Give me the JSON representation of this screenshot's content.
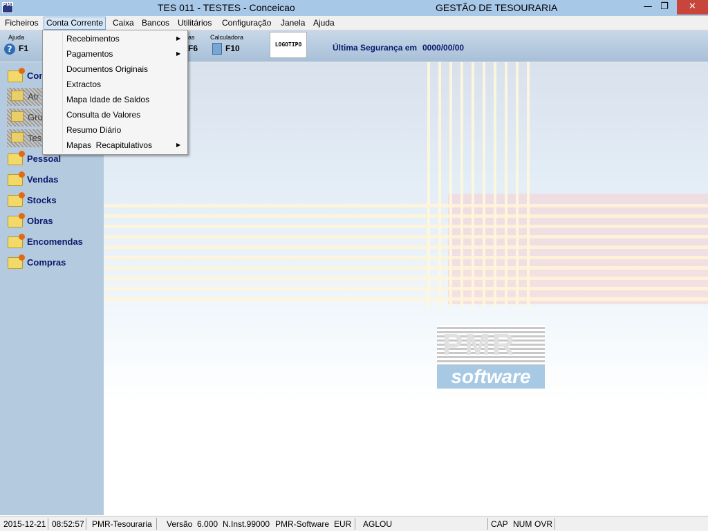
{
  "window": {
    "icon_text": "PMR",
    "title": "TES 011 - TESTES - Conceicao",
    "app_heading": "GESTÃO DE TESOURARIA",
    "min_glyph": "—",
    "restore_glyph": "❐",
    "close_glyph": "✕"
  },
  "menubar": {
    "items": [
      "Ficheiros",
      "Conta Corrente",
      "Caixa",
      "Bancos",
      "Utilitários",
      "Configuração",
      "Janela",
      "Ajuda"
    ],
    "active": "Conta Corrente"
  },
  "toolbar": {
    "help_label": "Ajuda",
    "help_key": "F1",
    "help_icon": "question-mark-icon",
    "caixas_label_partial": "as",
    "caixas_key": "F6",
    "calc_label": "Calculadora",
    "calc_key": "F10",
    "calc_icon": "calculator-icon",
    "logo_text": "LOGOTIPO",
    "security_label": "Última Segurança em",
    "security_value": "0000/00/00"
  },
  "sidebar": {
    "items": [
      {
        "label": "Con",
        "icon": "folder-icon"
      },
      {
        "label": "Pessoal",
        "icon": "folder-icon"
      },
      {
        "label": "Vendas",
        "icon": "folder-icon"
      },
      {
        "label": "Stocks",
        "icon": "folder-icon"
      },
      {
        "label": "Obras",
        "icon": "folder-icon"
      },
      {
        "label": "Encomendas",
        "icon": "folder-icon"
      },
      {
        "label": "Compras",
        "icon": "folder-icon"
      }
    ],
    "subitems": [
      {
        "label": "Atr"
      },
      {
        "label": "Gru"
      },
      {
        "label": "Tes"
      }
    ]
  },
  "dropdown": {
    "items": [
      {
        "label": "Recebimentos",
        "submenu": true
      },
      {
        "label": "Pagamentos",
        "submenu": true
      },
      {
        "label": "Documentos Originais",
        "submenu": false
      },
      {
        "label": "Extractos",
        "submenu": false
      },
      {
        "label": "Mapa Idade de Saldos",
        "submenu": false
      },
      {
        "label": "Consulta de Valores",
        "submenu": false
      },
      {
        "label": "Resumo Diário",
        "submenu": false
      },
      {
        "label": "Mapas  Recapitulativos",
        "submenu": true
      }
    ],
    "arrow_glyph": "▶"
  },
  "workspace": {
    "logo_top": "PMR",
    "logo_bottom": "software"
  },
  "statusbar": {
    "date": "2015-12-21",
    "time": "08:52:57",
    "app": "PMR-Tesouraria",
    "version": "Versão  6.000",
    "inst": "N.Inst.99000",
    "vendor": "PMR-Software",
    "currency": "EUR",
    "user": "AGLOU",
    "cap": "CAP",
    "num": "NUM",
    "ovr": "OVR"
  }
}
